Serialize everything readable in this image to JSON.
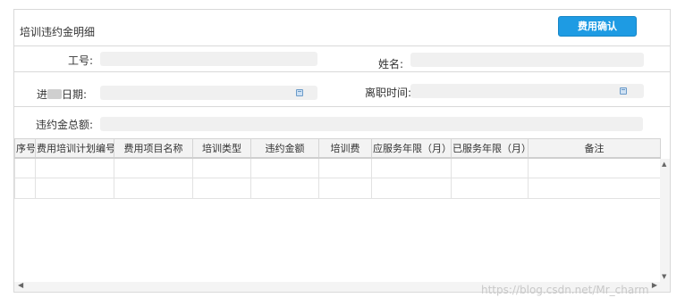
{
  "panel": {
    "title": "培训违约金明细",
    "confirm_button": "费用确认"
  },
  "form": {
    "employee_id_label": "工号:",
    "name_label": "姓名:",
    "entry_date_label_prefix": "进",
    "entry_date_label_suffix": "日期:",
    "leave_date_label": "离职时间:",
    "total_penalty_label": "违约金总额:",
    "employee_id_value": "",
    "name_value": "",
    "entry_date_value": "",
    "leave_date_value": "",
    "total_penalty_value": ""
  },
  "table": {
    "columns": [
      "序号",
      "费用培训计划编号",
      "费用项目名称",
      "培训类型",
      "违约金额",
      "培训费",
      "应服务年限（月）",
      "已服务年限（月）",
      "备注"
    ],
    "rows": [
      [
        "",
        "",
        "",
        "",
        "",
        "",
        "",
        "",
        ""
      ],
      [
        "",
        "",
        "",
        "",
        "",
        "",
        "",
        "",
        ""
      ]
    ]
  },
  "icons": {
    "calendar": "calendar-icon",
    "scroll_up": "scroll-up-arrow-icon",
    "scroll_down": "scroll-down-arrow-icon",
    "scroll_left": "scroll-left-arrow-icon",
    "scroll_right": "scroll-right-arrow-icon"
  },
  "colors": {
    "accent": "#1e9be3",
    "field_bg": "#f0f0f0",
    "border": "#d9d9d9"
  },
  "watermark": "https://blog.csdn.net/Mr_charm"
}
